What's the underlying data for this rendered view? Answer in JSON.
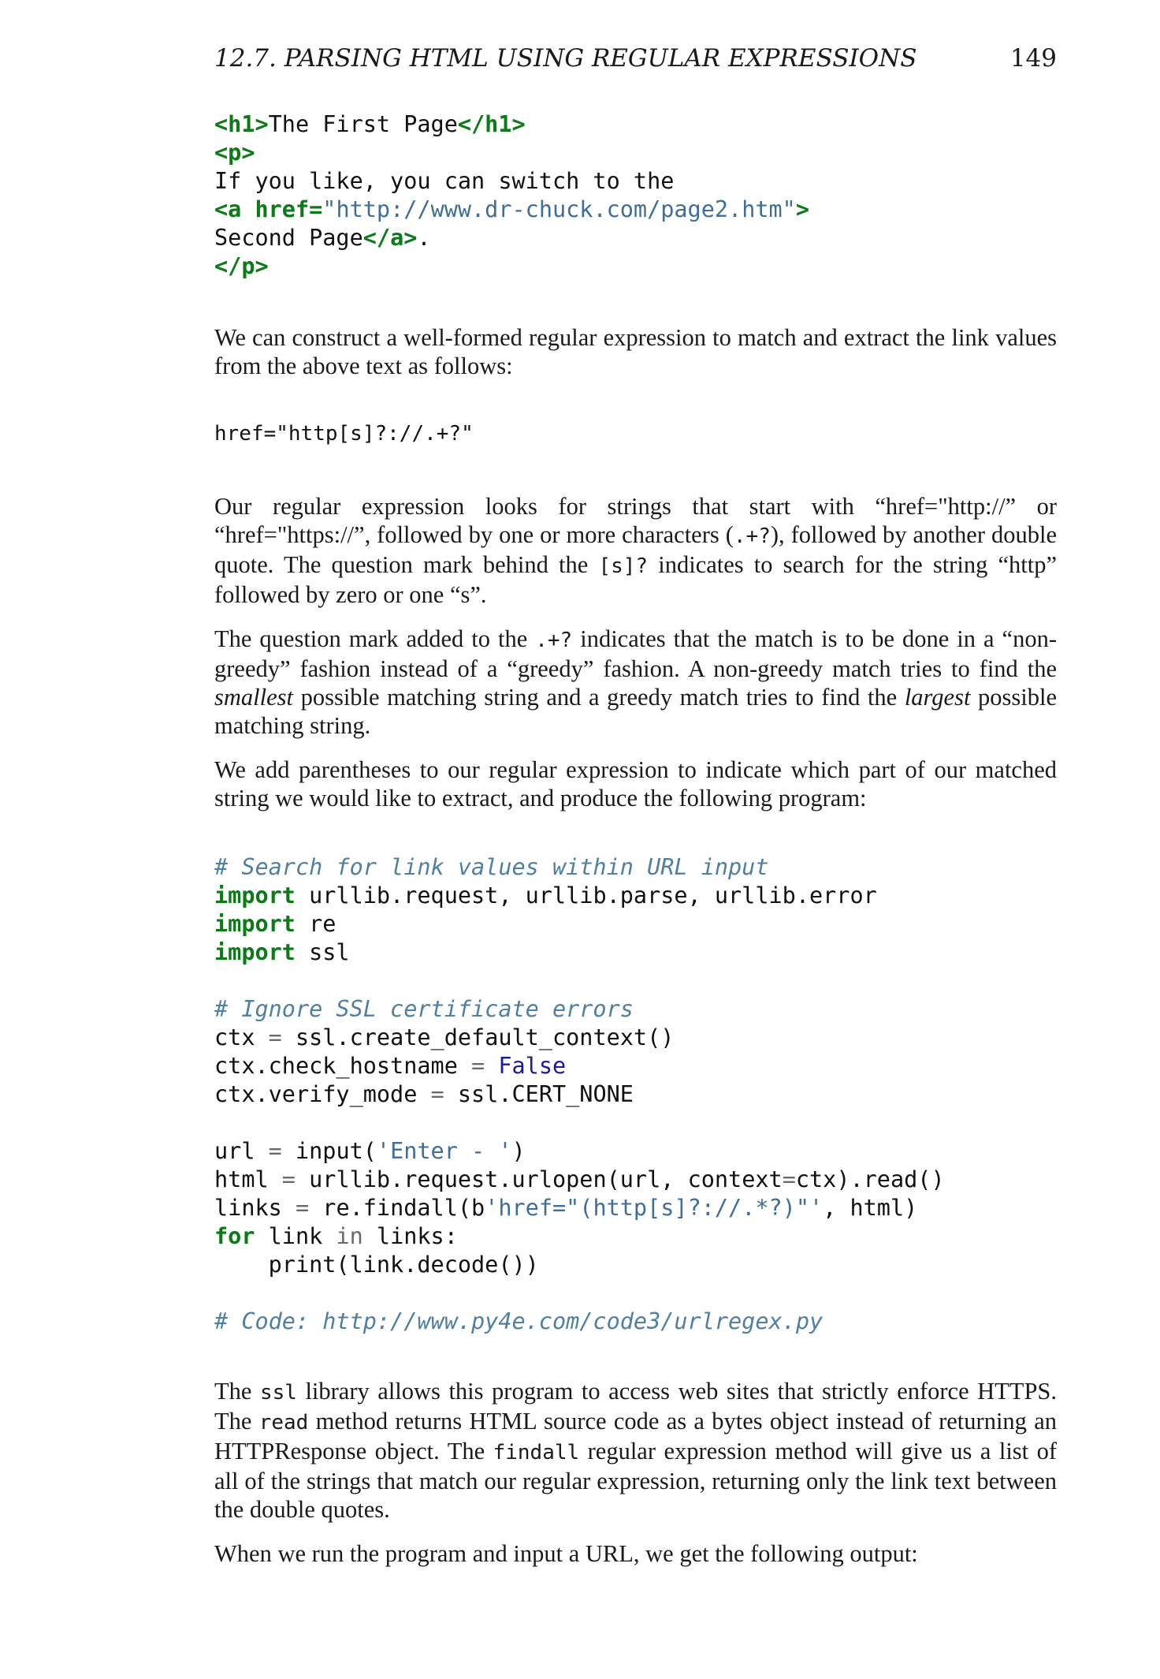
{
  "header": {
    "section_title": "12.7.  PARSING HTML USING REGULAR EXPRESSIONS",
    "page_number": "149"
  },
  "html_example": {
    "line1_open": "<h1>",
    "line1_text": "The First Page",
    "line1_close": "</h1>",
    "line2": "<p>",
    "line3": "If you like, you can switch to the",
    "line4_tag": "<a ",
    "line4_attr": "href=",
    "line4_value": "\"http://www.dr-chuck.com/page2.htm\"",
    "line4_end": ">",
    "line5_text": "Second Page",
    "line5_close": "</a>",
    "line5_period": ".",
    "line6": "</p>"
  },
  "para1": "We can construct a well-formed regular expression to match and extract the link values from the above text as follows:",
  "regex_line": "href=\"http[s]?://.+?\"",
  "para2": {
    "part1": "Our regular expression looks for strings that start with “href=\"http://” or “href=\"https://”, followed by one or more characters (",
    "code1": ".+?",
    "part2": "), followed by another double quote.  The question mark behind the ",
    "code2": "[s]?",
    "part3": " indicates to search for the string “http” followed by zero or one “s”."
  },
  "para3": {
    "part1": "The question mark added to the ",
    "code1": ".+?",
    "part2": " indicates that the match is to be done in a “non-greedy” fashion instead of a “greedy” fashion.  A non-greedy match tries to find the ",
    "em1": "smallest",
    "part3": " possible matching string and a greedy match tries to find the ",
    "em2": "largest",
    "part4": " possible matching string."
  },
  "para4": "We add parentheses to our regular expression to indicate which part of our matched string we would like to extract, and produce the following program:",
  "program": {
    "c1": "# Search for link values within URL input",
    "l2_kw": "import",
    "l2_rest": " urllib.request, urllib.parse, urllib.error",
    "l3_kw": "import",
    "l3_rest": " re",
    "l4_kw": "import",
    "l4_rest": " ssl",
    "c2": "# Ignore SSL certificate errors",
    "l6_a": "ctx ",
    "l6_op": "=",
    "l6_b": " ssl.create_default_context()",
    "l7_a": "ctx.check_hostname ",
    "l7_op": "=",
    "l7_sp": " ",
    "l7_b": "False",
    "l8_a": "ctx.verify_mode ",
    "l8_op": "=",
    "l8_b": " ssl.CERT_NONE",
    "l10_a": "url ",
    "l10_op": "=",
    "l10_b": " input(",
    "l10_str": "'Enter - '",
    "l10_c": ")",
    "l11_a": "html ",
    "l11_op": "=",
    "l11_b": " urllib.request.urlopen(url, context",
    "l11_op2": "=",
    "l11_c": "ctx).read()",
    "l12_a": "links ",
    "l12_op": "=",
    "l12_b": " re.findall(b",
    "l12_str": "'href=\"(http[s]?://.*?)\"'",
    "l12_c": ", html)",
    "l13_kw": "for",
    "l13_a": " link ",
    "l13_in": "in",
    "l13_b": " links:",
    "l14": "    print(link.decode())",
    "c3": "# Code: http://www.py4e.com/code3/urlregex.py"
  },
  "para5": {
    "part1": "The ",
    "code1": "ssl",
    "part2": " library allows this program to access web sites that strictly enforce HTTPS. The ",
    "code2": "read",
    "part3": " method returns HTML source code as a bytes object instead of returning an HTTPResponse object. The ",
    "code3": "findall",
    "part4": " regular expression method will give us a list of all of the strings that match our regular expression, returning only the link text between the double quotes."
  },
  "para6": "When we run the program and input a URL, we get the following output:",
  "colors": {
    "keyword": "#0b7a17",
    "string": "#3e6e99",
    "comment": "#4f7fa3",
    "builtin_constant": "#1a1aa0"
  }
}
